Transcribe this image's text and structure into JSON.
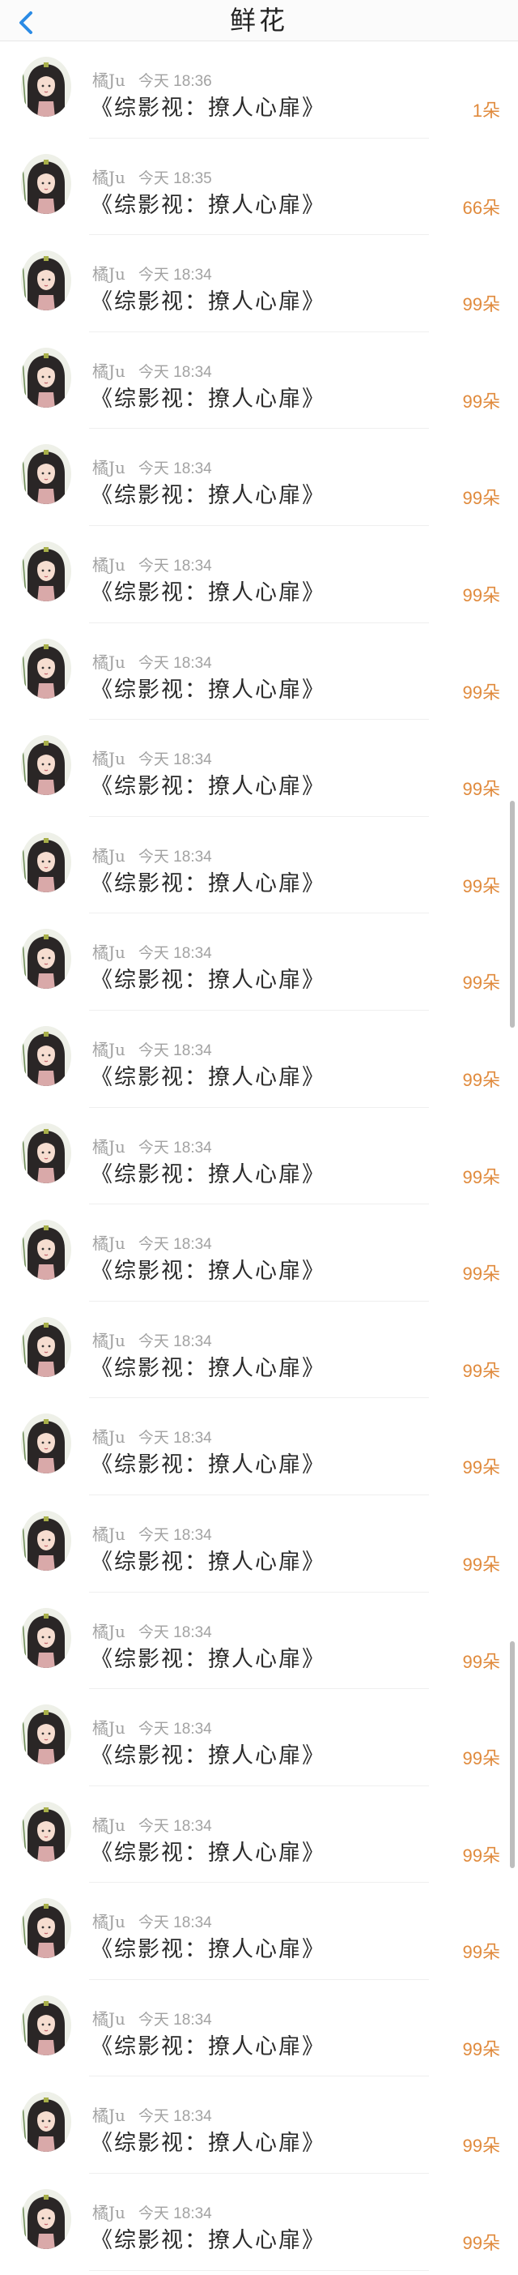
{
  "header": {
    "title": "鲜花",
    "back_icon": "chevron-left-icon",
    "accent_color": "#2b8be5"
  },
  "items": [
    {
      "user": "橘Ju",
      "time": "今天 18:36",
      "book": "《综影视：撩人心扉》",
      "count": "1朵"
    },
    {
      "user": "橘Ju",
      "time": "今天 18:35",
      "book": "《综影视：撩人心扉》",
      "count": "66朵"
    },
    {
      "user": "橘Ju",
      "time": "今天 18:34",
      "book": "《综影视：撩人心扉》",
      "count": "99朵"
    },
    {
      "user": "橘Ju",
      "time": "今天 18:34",
      "book": "《综影视：撩人心扉》",
      "count": "99朵"
    },
    {
      "user": "橘Ju",
      "time": "今天 18:34",
      "book": "《综影视：撩人心扉》",
      "count": "99朵"
    },
    {
      "user": "橘Ju",
      "time": "今天 18:34",
      "book": "《综影视：撩人心扉》",
      "count": "99朵"
    },
    {
      "user": "橘Ju",
      "time": "今天 18:34",
      "book": "《综影视：撩人心扉》",
      "count": "99朵"
    },
    {
      "user": "橘Ju",
      "time": "今天 18:34",
      "book": "《综影视：撩人心扉》",
      "count": "99朵"
    },
    {
      "user": "橘Ju",
      "time": "今天 18:34",
      "book": "《综影视：撩人心扉》",
      "count": "99朵"
    },
    {
      "user": "橘Ju",
      "time": "今天 18:34",
      "book": "《综影视：撩人心扉》",
      "count": "99朵"
    },
    {
      "user": "橘Ju",
      "time": "今天 18:34",
      "book": "《综影视：撩人心扉》",
      "count": "99朵"
    },
    {
      "user": "橘Ju",
      "time": "今天 18:34",
      "book": "《综影视：撩人心扉》",
      "count": "99朵"
    },
    {
      "user": "橘Ju",
      "time": "今天 18:34",
      "book": "《综影视：撩人心扉》",
      "count": "99朵"
    },
    {
      "user": "橘Ju",
      "time": "今天 18:34",
      "book": "《综影视：撩人心扉》",
      "count": "99朵"
    },
    {
      "user": "橘Ju",
      "time": "今天 18:34",
      "book": "《综影视：撩人心扉》",
      "count": "99朵"
    },
    {
      "user": "橘Ju",
      "time": "今天 18:34",
      "book": "《综影视：撩人心扉》",
      "count": "99朵"
    },
    {
      "user": "橘Ju",
      "time": "今天 18:34",
      "book": "《综影视：撩人心扉》",
      "count": "99朵"
    },
    {
      "user": "橘Ju",
      "time": "今天 18:34",
      "book": "《综影视：撩人心扉》",
      "count": "99朵"
    },
    {
      "user": "橘Ju",
      "time": "今天 18:34",
      "book": "《综影视：撩人心扉》",
      "count": "99朵"
    },
    {
      "user": "橘Ju",
      "time": "今天 18:34",
      "book": "《综影视：撩人心扉》",
      "count": "99朵"
    },
    {
      "user": "橘Ju",
      "time": "今天 18:34",
      "book": "《综影视：撩人心扉》",
      "count": "99朵"
    },
    {
      "user": "橘Ju",
      "time": "今天 18:34",
      "book": "《综影视：撩人心扉》",
      "count": "99朵"
    },
    {
      "user": "橘Ju",
      "time": "今天 18:34",
      "book": "《综影视：撩人心扉》",
      "count": "99朵"
    }
  ],
  "colors": {
    "count": "#e08a3c",
    "meta": "#a2a2a2",
    "book": "#2b2b2b",
    "divider": "#efefef"
  }
}
